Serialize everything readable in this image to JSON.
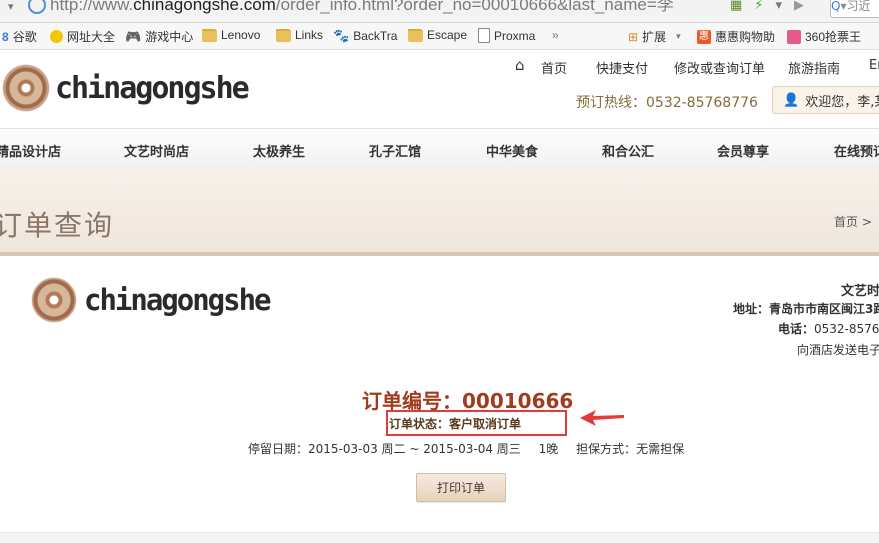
{
  "browser": {
    "url_prefix": "http://www.",
    "url_domain": "chinagongshe.com",
    "url_path": "/order_info.html?order_no=00010666&last_name=李",
    "search_placeholder": "习近"
  },
  "bookmarks": [
    {
      "label": "谷歌",
      "icon": "google-icon"
    },
    {
      "label": "网址大全",
      "icon": "nav-icon"
    },
    {
      "label": "游戏中心",
      "icon": "gamepad-icon"
    },
    {
      "label": "Lenovo",
      "icon": "folder-icon"
    },
    {
      "label": "Links",
      "icon": "folder-icon"
    },
    {
      "label": "BackTra",
      "icon": "paw-icon"
    },
    {
      "label": "Escape",
      "icon": "folder-icon"
    },
    {
      "label": "Proxma",
      "icon": "doc-icon"
    },
    {
      "label": "»",
      "icon": ""
    },
    {
      "label": "扩展",
      "icon": "grid-icon"
    },
    {
      "label": "惠惠购物助",
      "icon": "shop-icon"
    },
    {
      "label": "360抢票王",
      "icon": "ticket-icon"
    }
  ],
  "header": {
    "top_links": [
      "首页",
      "快捷支付",
      "修改或查询订单",
      "旅游指南",
      "En"
    ],
    "hotline": "预订热线：0532-85768776",
    "welcome": "欢迎您，李,某"
  },
  "nav": [
    "精品设计店",
    "文艺时尚店",
    "太极养生",
    "孔子汇馆",
    "中华美食",
    "和合公汇",
    "会员尊享",
    "在线预订"
  ],
  "banner": {
    "title": "订单查询",
    "breadcrumb": "首页 >"
  },
  "hotel": {
    "name": "文艺时",
    "address_label": "地址：",
    "address": "青岛市市南区闽江3路",
    "phone_label": "电话：",
    "phone": "0532-8576",
    "email_note": "向酒店发送电子"
  },
  "order": {
    "number_label": "订单编号：00010666",
    "status_label": "订单状态：",
    "status_value": "客户取消订单",
    "stay_dates": "停留日期：2015-03-03 周二 ~ 2015-03-04 周三",
    "nights": "1晚",
    "guarantee": "担保方式：无需担保",
    "print_button": "打印订单"
  },
  "colors": {
    "accent": "#a03b1e",
    "annotation": "#e23b3b",
    "banner_bg": "#f7f0e9"
  }
}
